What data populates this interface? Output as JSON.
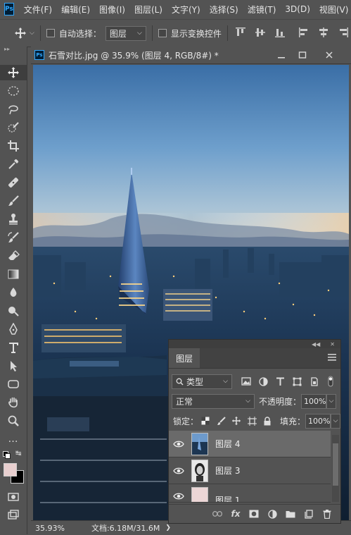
{
  "app": {
    "logo_text": "Ps"
  },
  "menubar": {
    "items": [
      "文件(F)",
      "编辑(E)",
      "图像(I)",
      "图层(L)",
      "文字(Y)",
      "选择(S)",
      "滤镜(T)",
      "3D(D)",
      "视图(V)"
    ]
  },
  "options": {
    "auto_select_label": "自动选择：",
    "auto_select_value": "图层",
    "transform_controls_label": "显示变换控件"
  },
  "document": {
    "icon_text": "Ps",
    "title": "石雪对比.jpg @ 35.9% (图层 4, RGB/8#) *",
    "zoom": "35.93%",
    "doc_info": "文档:6.18M/31.6M"
  },
  "layers_panel": {
    "title": "图层",
    "filter_kind": "类型",
    "blend_mode": "正常",
    "opacity_label": "不透明度：",
    "opacity_value": "100%",
    "lock_label": "锁定：",
    "fill_label": "填充：",
    "fill_value": "100%",
    "layers": [
      {
        "name": "图层 4",
        "selected": true
      },
      {
        "name": "图层 3",
        "selected": false
      },
      {
        "name": "图层 1",
        "selected": false
      }
    ],
    "footer_fx": "fx"
  },
  "colors": {
    "ui_background": "#535353",
    "panel_dark": "#3e3e3e",
    "foreground_swatch": "#e8cfcf",
    "background_swatch": "#000000",
    "ps_blue": "#31a8ff"
  }
}
